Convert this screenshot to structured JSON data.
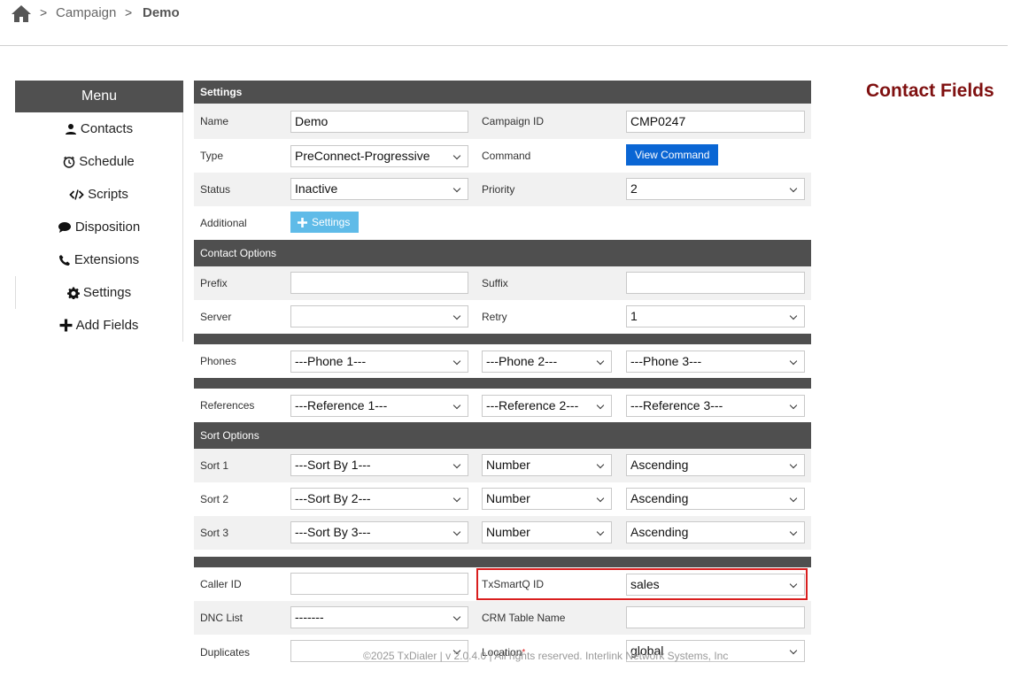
{
  "breadcrumb": {
    "items": [
      "Campaign",
      "Demo"
    ],
    "separator": ">"
  },
  "page_title": "Contact Fields",
  "menu": {
    "title": "Menu",
    "items": [
      {
        "label": "Contacts",
        "icon": "user-icon"
      },
      {
        "label": "Schedule",
        "icon": "clock-icon"
      },
      {
        "label": "Scripts",
        "icon": "code-icon"
      },
      {
        "label": "Disposition",
        "icon": "comment-icon"
      },
      {
        "label": "Extensions",
        "icon": "phone-icon"
      },
      {
        "label": "Settings",
        "icon": "gear-icon"
      },
      {
        "label": "Add Fields",
        "icon": "plus-icon"
      }
    ],
    "active": "Settings"
  },
  "settings": {
    "section": "Settings",
    "name_label": "Name",
    "name_value": "Demo",
    "campaign_id_label": "Campaign ID",
    "campaign_id_value": "CMP0247",
    "type_label": "Type",
    "type_value": "PreConnect-Progressive",
    "command_label": "Command",
    "command_button": "View Command",
    "status_label": "Status",
    "status_value": "Inactive",
    "priority_label": "Priority",
    "priority_value": "2",
    "additional_label": "Additional",
    "additional_button": "Settings"
  },
  "contact_options": {
    "section": "Contact Options",
    "prefix_label": "Prefix",
    "prefix_value": "",
    "suffix_label": "Suffix",
    "suffix_value": "",
    "server_label": "Server",
    "server_value": "",
    "retry_label": "Retry",
    "retry_value": "1"
  },
  "phones": {
    "label": "Phones",
    "values": [
      "---Phone 1---",
      "---Phone 2---",
      "---Phone 3---"
    ]
  },
  "references": {
    "label": "References",
    "values": [
      "---Reference 1---",
      "---Reference 2---",
      "---Reference 3---"
    ]
  },
  "sort_options": {
    "section": "Sort Options",
    "rows": [
      {
        "label": "Sort 1",
        "by": "---Sort By 1---",
        "field": "Number",
        "order": "Ascending"
      },
      {
        "label": "Sort 2",
        "by": "---Sort By 2---",
        "field": "Number",
        "order": "Ascending"
      },
      {
        "label": "Sort 3",
        "by": "---Sort By 3---",
        "field": "Number",
        "order": "Ascending"
      }
    ]
  },
  "other": {
    "caller_id_label": "Caller ID",
    "caller_id_value": "",
    "txsmartq_label": "TxSmartQ ID",
    "txsmartq_value": "sales",
    "dnc_label": "DNC List",
    "dnc_value": "-------",
    "crm_label": "CRM Table Name",
    "crm_value": "",
    "duplicates_label": "Duplicates",
    "duplicates_value": "",
    "location_label": "Location",
    "location_required": "*",
    "location_value": "global"
  },
  "footer": "©2025 TxDialer | v 2.0.4.0 | All rights reserved. Interlink Network Systems, Inc",
  "colors": {
    "header_bg": "#4f4f4f",
    "accent_blue": "#0a66d4",
    "light_blue": "#5fbbe8",
    "title_red": "#7f1010",
    "highlight": "#d91e1e"
  }
}
